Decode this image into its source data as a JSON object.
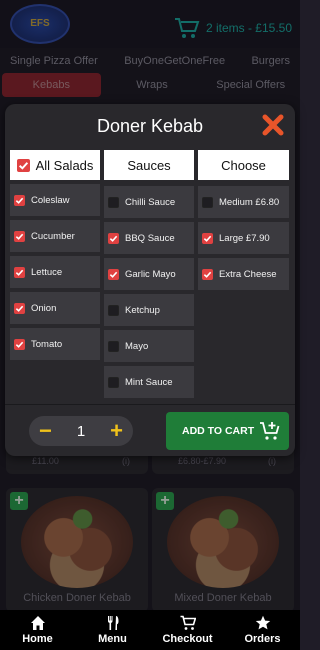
{
  "header": {
    "logo_text": "EFS",
    "cart_text": "2 items - £15.50"
  },
  "categories_row1": [
    "Single Pizza Offer",
    "BuyOneGetOneFree",
    "Burgers"
  ],
  "categories_row2": [
    {
      "label": "Kebabs",
      "active": true
    },
    {
      "label": "Wraps",
      "active": false
    },
    {
      "label": "Special Offers",
      "active": false
    }
  ],
  "products": {
    "top_left": {
      "price": "£11.00",
      "info": "(i)"
    },
    "top_right": {
      "price": "£6.80-£7.90",
      "info": "(i)"
    },
    "bottom_left": {
      "name": "Chicken Doner Kebab",
      "add": "+"
    },
    "bottom_right": {
      "name": "Mixed Doner Kebab",
      "add": "+"
    }
  },
  "modal": {
    "title": "Doner Kebab",
    "columns": [
      {
        "header": "All Salads",
        "header_checked": true,
        "options": [
          {
            "label": "Coleslaw",
            "checked": true
          },
          {
            "label": "Cucumber",
            "checked": true
          },
          {
            "label": "Lettuce",
            "checked": true
          },
          {
            "label": "Onion",
            "checked": true
          },
          {
            "label": "Tomato",
            "checked": true
          }
        ]
      },
      {
        "header": "Sauces",
        "options": [
          {
            "label": "Chilli Sauce",
            "checked": false
          },
          {
            "label": "BBQ Sauce",
            "checked": true
          },
          {
            "label": "Garlic Mayo",
            "checked": true
          },
          {
            "label": "Ketchup",
            "checked": false
          },
          {
            "label": "Mayo",
            "checked": false
          },
          {
            "label": "Mint Sauce",
            "checked": false
          }
        ]
      },
      {
        "header": "Choose",
        "options": [
          {
            "label": "Medium £6.80",
            "checked": false
          },
          {
            "label": "Large £7.90",
            "checked": true
          },
          {
            "label": "Extra Cheese",
            "checked": true
          }
        ]
      }
    ],
    "quantity": "1",
    "minus": "−",
    "plus": "+",
    "add_to_cart": "ADD TO CART"
  },
  "bottom_nav": [
    {
      "label": "Home",
      "icon": "home-icon"
    },
    {
      "label": "Menu",
      "icon": "cutlery-icon"
    },
    {
      "label": "Checkout",
      "icon": "cart-icon"
    },
    {
      "label": "Orders",
      "icon": "star-icon"
    }
  ],
  "colors": {
    "accent_red": "#e04141",
    "cart_green": "#1f7d38",
    "qty_yellow": "#f0c21b",
    "cart_text": "#1fd8c9"
  }
}
